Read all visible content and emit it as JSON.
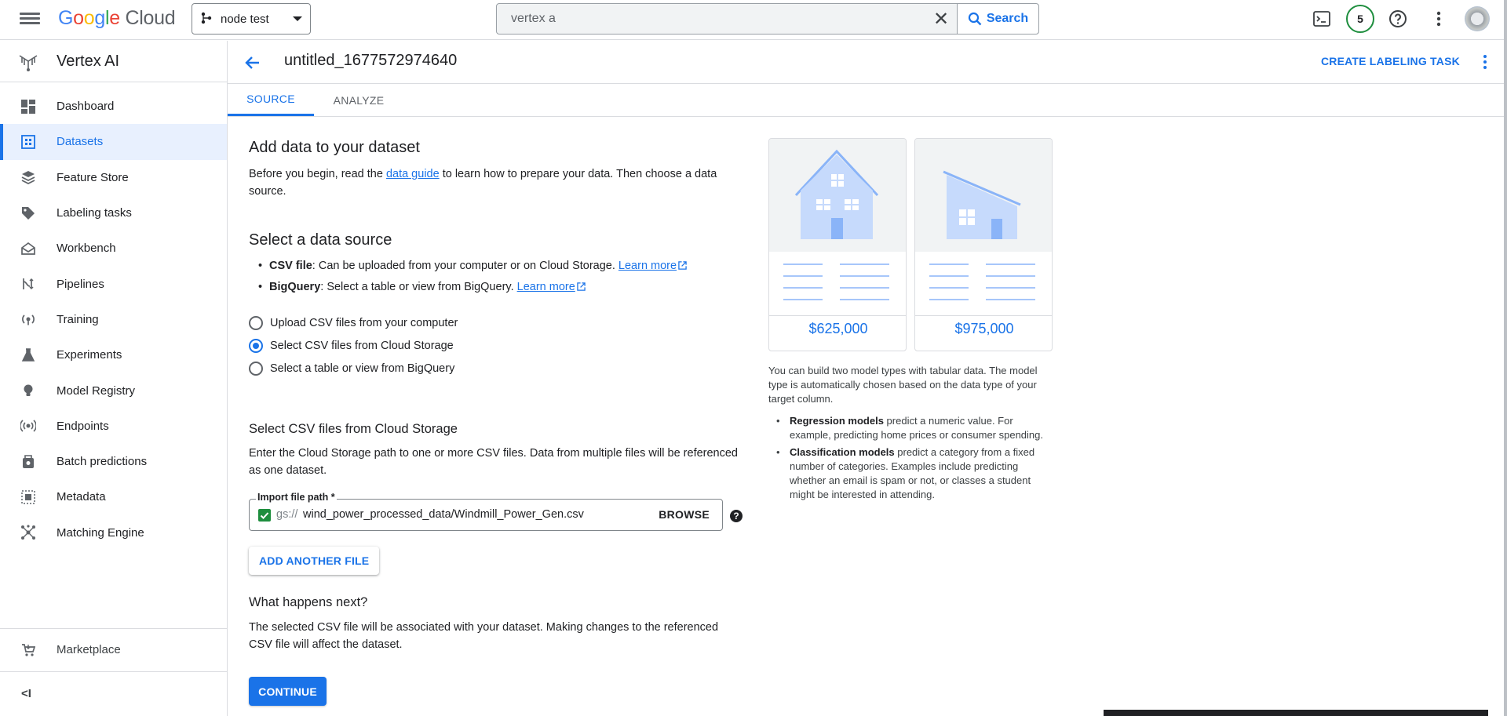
{
  "topbar": {
    "logo": {
      "google": "Google",
      "cloud": "Cloud"
    },
    "project": "node test",
    "search": {
      "value": "vertex a",
      "button": "Search"
    },
    "notifications_count": "5"
  },
  "sidebar": {
    "product": "Vertex AI",
    "items": [
      {
        "label": "Dashboard",
        "icon": "dashboard-icon"
      },
      {
        "label": "Datasets",
        "icon": "datasets-icon",
        "active": true
      },
      {
        "label": "Feature Store",
        "icon": "feature-store-icon"
      },
      {
        "label": "Labeling tasks",
        "icon": "labeling-tag-icon"
      },
      {
        "label": "Workbench",
        "icon": "workbench-icon"
      },
      {
        "label": "Pipelines",
        "icon": "pipelines-icon"
      },
      {
        "label": "Training",
        "icon": "training-icon"
      },
      {
        "label": "Experiments",
        "icon": "experiments-flask-icon"
      },
      {
        "label": "Model Registry",
        "icon": "model-registry-bulb-icon"
      },
      {
        "label": "Endpoints",
        "icon": "endpoints-icon"
      },
      {
        "label": "Batch predictions",
        "icon": "batch-predictions-icon"
      },
      {
        "label": "Metadata",
        "icon": "metadata-icon"
      },
      {
        "label": "Matching Engine",
        "icon": "matching-engine-icon"
      }
    ],
    "marketplace": "Marketplace",
    "collapse": "<I"
  },
  "header": {
    "title": "untitled_1677572974640",
    "create_task": "CREATE LABELING TASK"
  },
  "tabs": [
    "SOURCE",
    "ANALYZE"
  ],
  "main": {
    "add_data_title": "Add data to your dataset",
    "intro_before": "Before you begin, read the ",
    "intro_link": "data guide",
    "intro_after": " to learn how to prepare your data. Then choose a data",
    "intro_line2": "source.",
    "select_source_title": "Select a data source",
    "sources": [
      {
        "name": "CSV file",
        "text": ": Can be uploaded from your computer or on Cloud Storage. ",
        "link": "Learn more"
      },
      {
        "name": "BigQuery",
        "text": ": Select a table or view from BigQuery. ",
        "link": "Learn more"
      }
    ],
    "radios": [
      {
        "label": "Upload CSV files from your computer",
        "selected": false
      },
      {
        "label": "Select CSV files from Cloud Storage",
        "selected": true
      },
      {
        "label": "Select a table or view from BigQuery",
        "selected": false
      }
    ],
    "gcs_title": "Select CSV files from Cloud Storage",
    "gcs_desc_1": "Enter the Cloud Storage path to one or more CSV files. Data from multiple files will be referenced",
    "gcs_desc_2": "as one dataset.",
    "field_label": "Import file path *",
    "field_prefix": "gs://",
    "field_value": "wind_power_processed_data/Windmill_Power_Gen.csv",
    "browse": "BROWSE",
    "help": "?",
    "add_file": "ADD ANOTHER FILE",
    "next_title": "What happens next?",
    "next_1": "The selected CSV file will be associated with your dataset. Making changes to the referenced",
    "next_2": "CSV file will affect the dataset.",
    "continue": "CONTINUE"
  },
  "info": {
    "prices": [
      "$625,000",
      "$975,000"
    ],
    "intro": "You can build two model types with tabular data. The model type is automatically chosen based on the data type of your target column.",
    "bullets": [
      {
        "bold": "Regression models",
        "text": " predict a numeric value. For example, predicting home prices or consumer spending."
      },
      {
        "bold": "Classification models",
        "text": " predict a category from a fixed number of categories. Examples include predicting whether an email is spam or not, or classes a student might be interested in attending."
      }
    ]
  },
  "colors": {
    "accent": "#1a73e8",
    "success": "#1e8e3e"
  }
}
